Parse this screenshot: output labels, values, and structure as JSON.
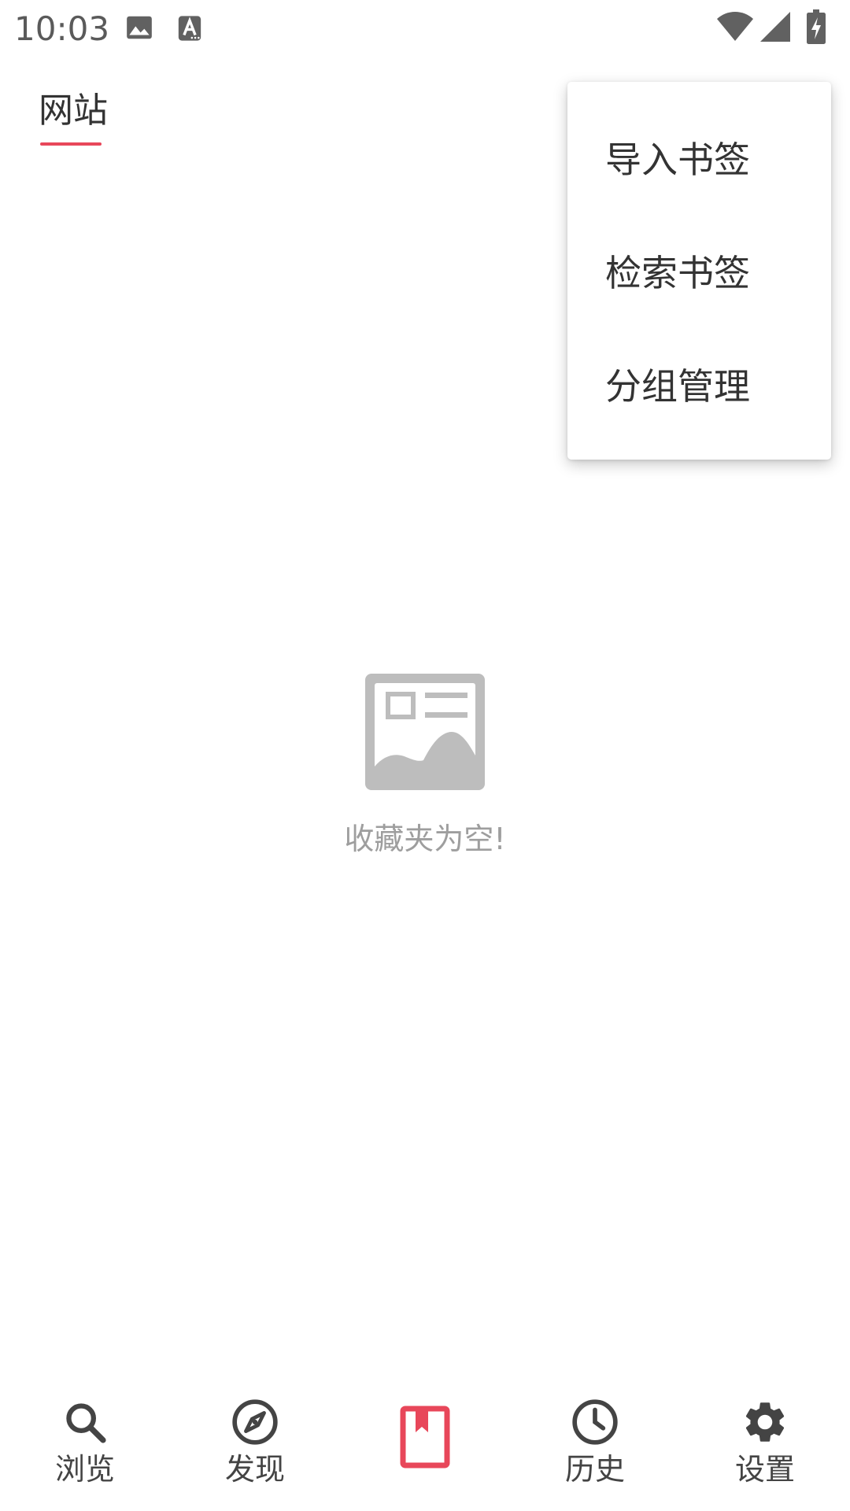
{
  "status_bar": {
    "time": "10:03",
    "icons": [
      "image-icon",
      "text-a-icon",
      "wifi-icon",
      "signal-icon",
      "battery-charging-icon"
    ]
  },
  "tabs": [
    {
      "label": "网站",
      "selected": true
    }
  ],
  "popup_menu": {
    "items": [
      {
        "label": "导入书签"
      },
      {
        "label": "检索书签"
      },
      {
        "label": "分组管理"
      }
    ]
  },
  "empty_state": {
    "icon": "image-placeholder-icon",
    "message": "收藏夹为空!"
  },
  "bottom_nav": {
    "items": [
      {
        "label": "浏览",
        "icon": "search-icon",
        "selected": false
      },
      {
        "label": "发现",
        "icon": "compass-icon",
        "selected": false
      },
      {
        "label": "",
        "icon": "bookmark-icon",
        "selected": true
      },
      {
        "label": "历史",
        "icon": "clock-icon",
        "selected": false
      },
      {
        "label": "设置",
        "icon": "gear-icon",
        "selected": false
      }
    ]
  },
  "colors": {
    "accent": "#e8475a",
    "icon_dark": "#444444",
    "placeholder_gray": "#bdbdbd",
    "empty_text": "#9e9e9e"
  }
}
